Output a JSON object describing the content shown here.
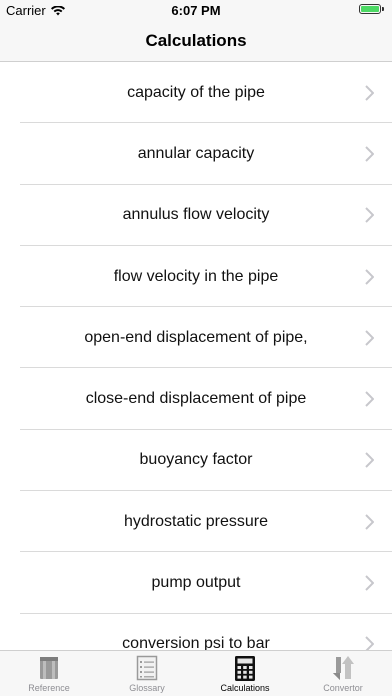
{
  "status_bar": {
    "carrier": "Carrier",
    "time": "6:07 PM",
    "wifi_icon": "wifi-icon",
    "battery_icon": "battery-icon",
    "battery_color": "#4cd964"
  },
  "nav": {
    "title": "Calculations"
  },
  "list": {
    "items": [
      {
        "label": "capacity of the pipe"
      },
      {
        "label": "annular capacity"
      },
      {
        "label": "annulus flow velocity"
      },
      {
        "label": "flow velocity in the pipe"
      },
      {
        "label": "open-end displacement of pipe,"
      },
      {
        "label": "close-end displacement of pipe"
      },
      {
        "label": "buoyancy factor"
      },
      {
        "label": "hydrostatic pressure"
      },
      {
        "label": "pump output"
      },
      {
        "label": "conversion psi to bar"
      }
    ],
    "chevron_icon": "chevron-right-icon"
  },
  "tabs": [
    {
      "label": "Reference",
      "icon": "book-icon",
      "active": false
    },
    {
      "label": "Glossary",
      "icon": "list-document-icon",
      "active": false
    },
    {
      "label": "Calculations",
      "icon": "calculator-icon",
      "active": true
    },
    {
      "label": "Convertor",
      "icon": "up-down-arrows-icon",
      "active": false
    }
  ]
}
